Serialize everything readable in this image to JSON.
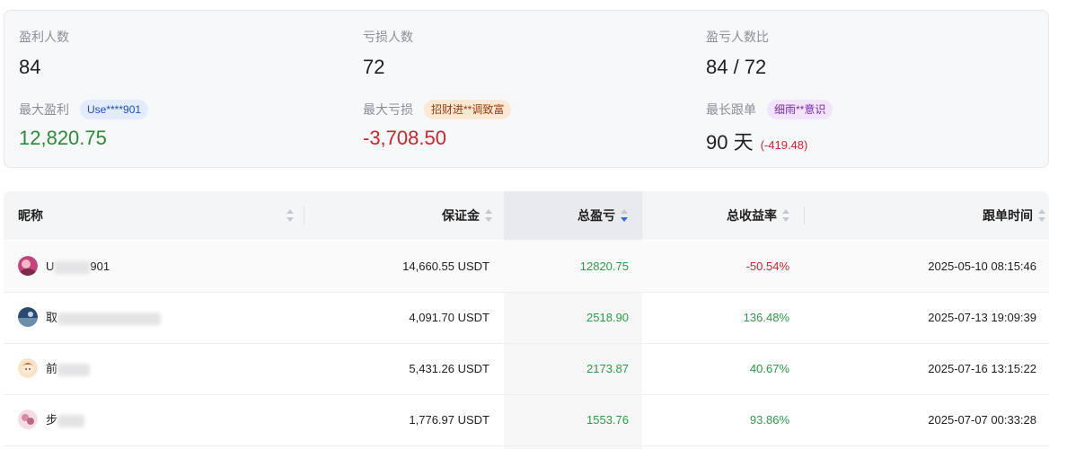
{
  "summary": {
    "profit_count_label": "盈利人数",
    "profit_count": "84",
    "loss_count_label": "亏损人数",
    "loss_count": "72",
    "ratio_label": "盈亏人数比",
    "ratio": "84 / 72",
    "max_profit_label": "最大盈利",
    "max_profit_user": "Use****901",
    "max_profit": "12,820.75",
    "max_loss_label": "最大亏损",
    "max_loss_user": "招财进**调致富",
    "max_loss": "-3,708.50",
    "longest_label": "最长跟单",
    "longest_user": "细雨**意识",
    "longest_days": "90 天",
    "longest_pnl": "(-419.48)"
  },
  "table": {
    "columns": {
      "nickname": "昵称",
      "margin": "保证金",
      "total_pnl": "总盈亏",
      "total_return": "总收益率",
      "follow_time": "跟单时间"
    },
    "rows": [
      {
        "nick_prefix": "U",
        "nick_suffix": "901",
        "margin": "14,660.55 USDT",
        "pnl": "12820.75",
        "return": "-50.54%",
        "return_color": "#c9252d",
        "time": "2025-05-10 08:15:46"
      },
      {
        "nick_prefix": "取",
        "nick_suffix": "",
        "margin": "4,091.70 USDT",
        "pnl": "2518.90",
        "return": "136.48%",
        "return_color": "#2c9a4a",
        "time": "2025-07-13 19:09:39"
      },
      {
        "nick_prefix": "前",
        "nick_suffix": "",
        "margin": "5,431.26 USDT",
        "pnl": "2173.87",
        "return": "40.67%",
        "return_color": "#2c9a4a",
        "time": "2025-07-16 13:15:22"
      },
      {
        "nick_prefix": "步",
        "nick_suffix": "",
        "margin": "1,776.97 USDT",
        "pnl": "1553.76",
        "return": "93.86%",
        "return_color": "#2c9a4a",
        "time": "2025-07-07 00:33:28"
      }
    ],
    "sort": {
      "column": "total_pnl",
      "direction": "descending"
    }
  },
  "colors": {
    "profit": "#2c8a3a",
    "loss": "#c9252d",
    "sort_active": "#2f6bdc"
  }
}
